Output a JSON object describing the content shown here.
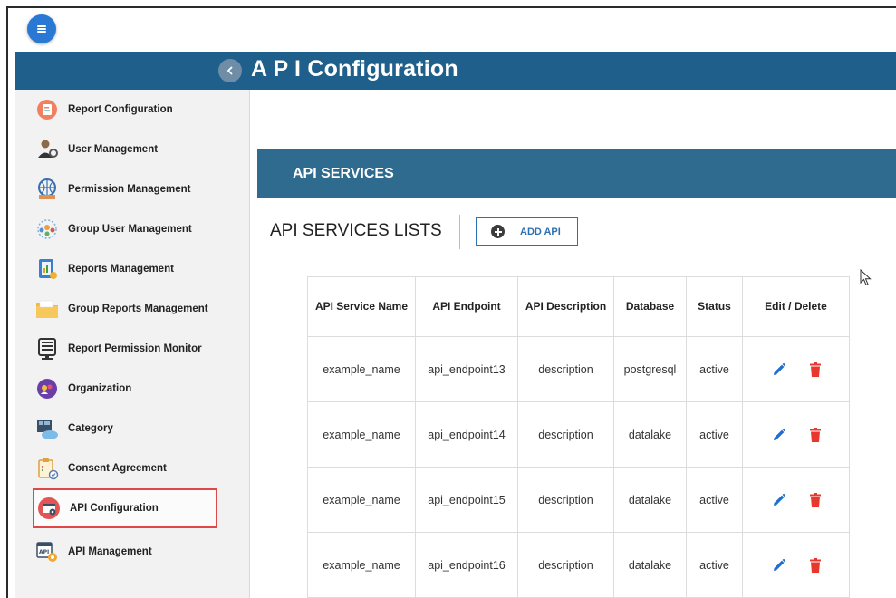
{
  "header": {
    "title": "A P I Configuration"
  },
  "sidebar": {
    "items": [
      {
        "label": "Report Configuration",
        "icon": "report-config-icon"
      },
      {
        "label": "User Management",
        "icon": "user-management-icon"
      },
      {
        "label": "Permission Management",
        "icon": "permission-management-icon"
      },
      {
        "label": "Group User Management",
        "icon": "group-user-icon"
      },
      {
        "label": "Reports Management",
        "icon": "reports-management-icon"
      },
      {
        "label": "Group Reports Management",
        "icon": "folder-icon"
      },
      {
        "label": "Report Permission Monitor",
        "icon": "monitor-icon"
      },
      {
        "label": "Organization",
        "icon": "organization-icon"
      },
      {
        "label": "Category",
        "icon": "category-icon"
      },
      {
        "label": "Consent Agreement",
        "icon": "consent-icon"
      },
      {
        "label": "API Configuration",
        "icon": "api-config-icon",
        "active": true
      },
      {
        "label": "API Management",
        "icon": "api-management-icon"
      }
    ]
  },
  "main": {
    "section_title": "API SERVICES",
    "list_title": "API SERVICES LISTS",
    "add_button_label": "ADD API",
    "table": {
      "columns": [
        "API Service Name",
        "API Endpoint",
        "API Description",
        "Database",
        "Status",
        "Edit / Delete"
      ],
      "rows": [
        {
          "name": "example_name",
          "endpoint": "api_endpoint13",
          "description": "description",
          "database": "postgresql",
          "status": "active"
        },
        {
          "name": "example_name",
          "endpoint": "api_endpoint14",
          "description": "description",
          "database": "datalake",
          "status": "active"
        },
        {
          "name": "example_name",
          "endpoint": "api_endpoint15",
          "description": "description",
          "database": "datalake",
          "status": "active"
        },
        {
          "name": "example_name",
          "endpoint": "api_endpoint16",
          "description": "description",
          "database": "datalake",
          "status": "active"
        }
      ]
    }
  },
  "colors": {
    "banner": "#1f5f8c",
    "section_header": "#2f6b8e",
    "accent_blue": "#2979d4",
    "delete_red": "#e8382e",
    "active_outline": "#e04848"
  }
}
